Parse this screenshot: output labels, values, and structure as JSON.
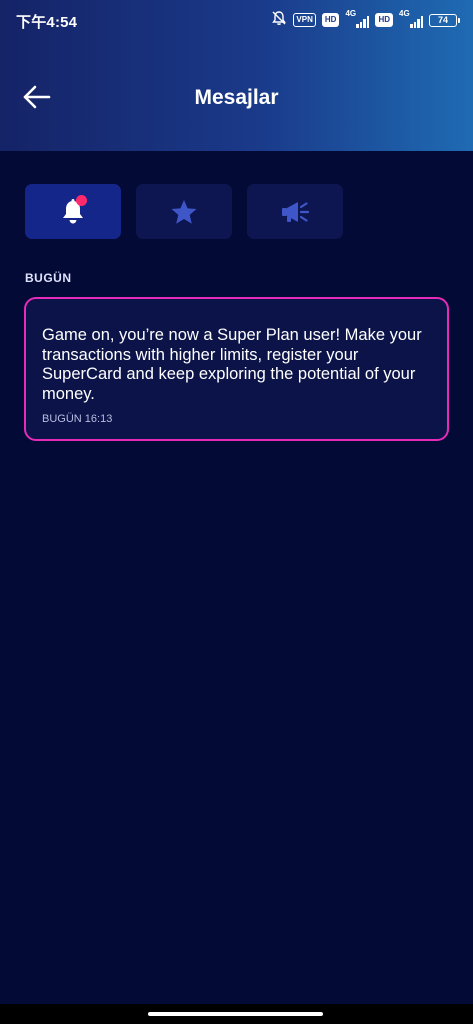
{
  "status_bar": {
    "time": "下午4:54",
    "vpn_label": "VPN",
    "hd_label": "HD",
    "network_label": "4G",
    "battery": "74"
  },
  "header": {
    "title": "Mesajlar",
    "back_icon": "arrow-left-icon"
  },
  "tabs": [
    {
      "icon": "bell-icon",
      "active": true,
      "has_badge": true
    },
    {
      "icon": "star-icon",
      "active": false
    },
    {
      "icon": "megaphone-icon",
      "active": false
    }
  ],
  "section": {
    "label": "BUGÜN"
  },
  "messages": [
    {
      "text": "Game on, you’re now a Super Plan user! Make your transactions with higher limits, register your SuperCard and keep exploring the potential of your money.",
      "time": "BUGÜN 16:13"
    }
  ],
  "colors": {
    "background": "#030a35",
    "accent": "#e52bb8",
    "badge": "#ff2a6d",
    "tab_active": "#15268a",
    "tab_inactive": "#0d1650"
  }
}
